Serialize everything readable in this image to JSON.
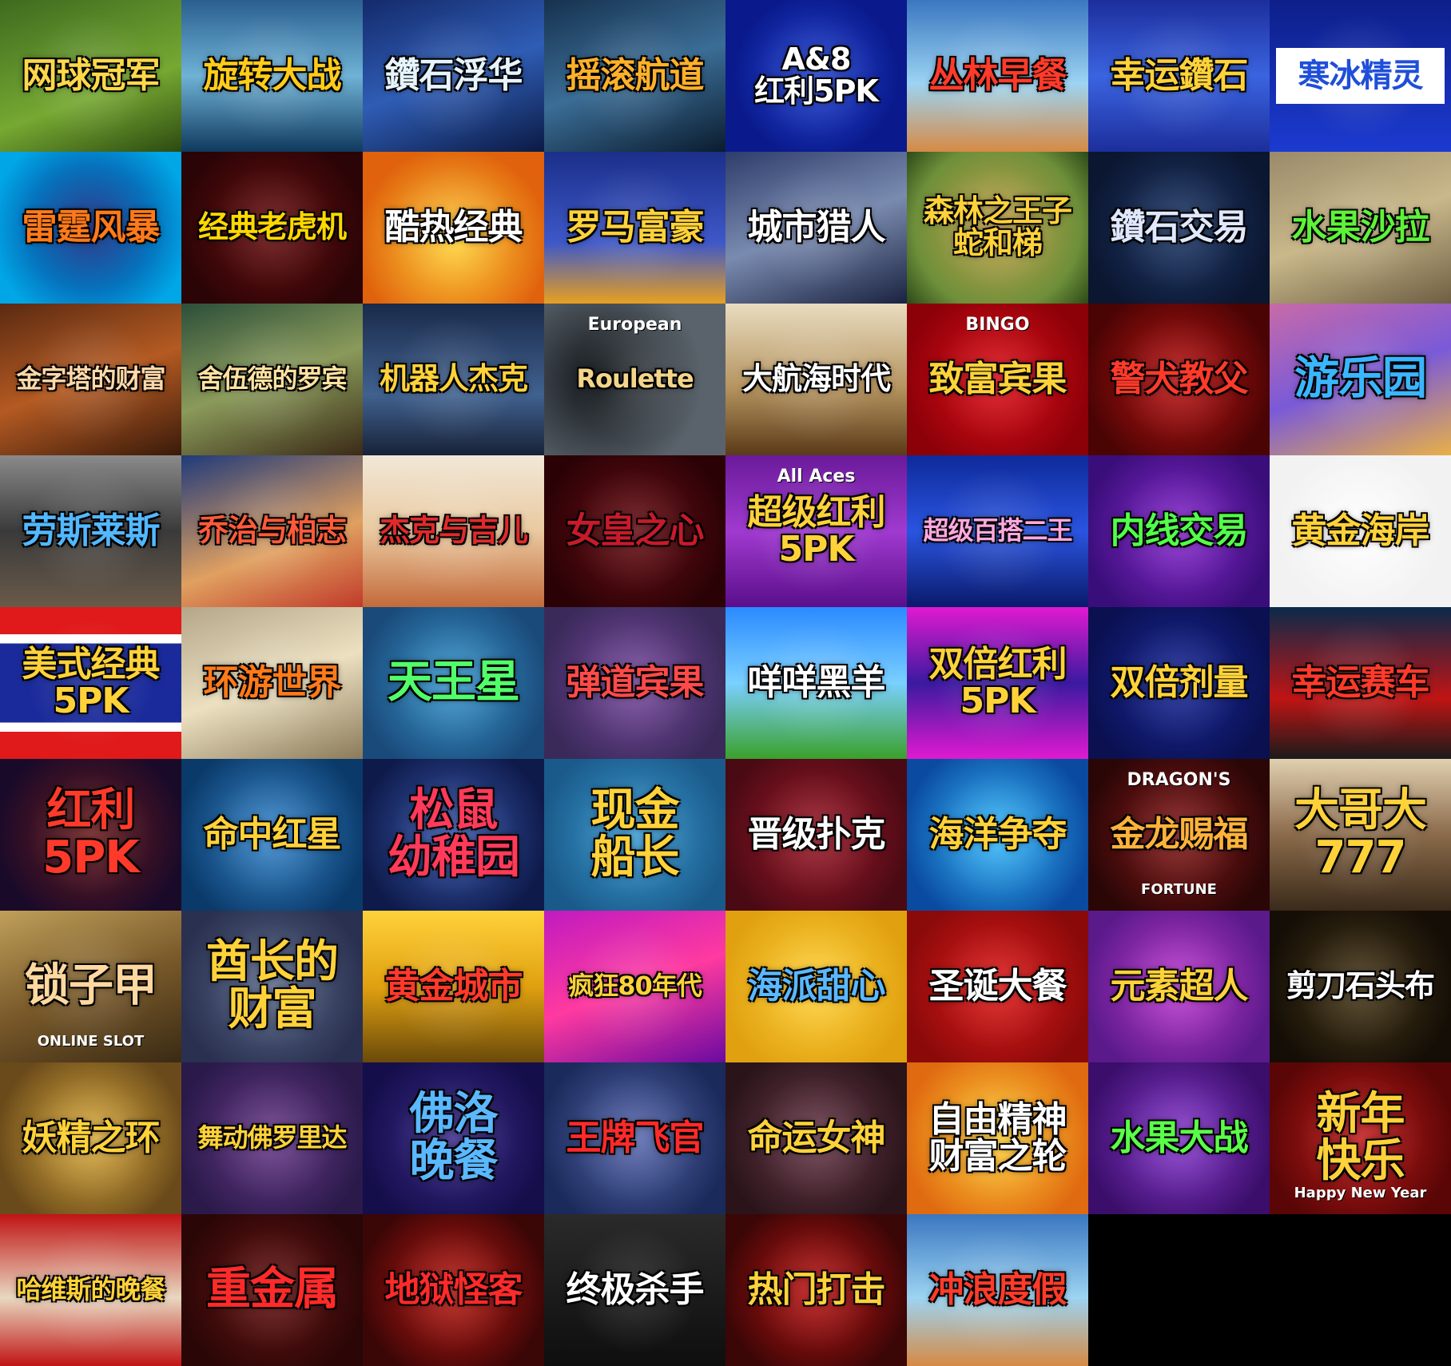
{
  "tiles": [
    {
      "label": "网球冠军",
      "bg": "linear-gradient(160deg,#3d6b1f,#76a832 60%,#2c4a10)",
      "color": "#ffd84a"
    },
    {
      "label": "旋转大战",
      "bg": "linear-gradient(180deg,#2a5f8f,#6fb2d6 50%,#0f3a5e)",
      "color": "#ffcc1a"
    },
    {
      "label": "鑽石浮华",
      "bg": "linear-gradient(160deg,#142a6b,#2f5db5 50%,#0b1a44)",
      "color": "#e6f4ff"
    },
    {
      "label": "摇滚航道",
      "bg": "linear-gradient(160deg,#16324f,#3b6d96 50%,#0a1c2e)",
      "color": "#ffb12a"
    },
    {
      "label": "A&8\n红利5PK",
      "bg": "radial-gradient(circle at 50% 50%,#2446d6,#0a1a8c 70%)",
      "color": "#ffffff"
    },
    {
      "label": "丛林早餐",
      "bg": "linear-gradient(180deg,#3a77c0,#9cd4f2 55%,#d68a44)",
      "color": "#ff3b2a"
    },
    {
      "label": "幸运鑽石",
      "bg": "linear-gradient(180deg,#1c2e9c,#3b64e0 50%,#1c2e9c)",
      "color": "#ffd23a"
    },
    {
      "label": "寒冰精灵",
      "bg": "linear-gradient(180deg,#0d1f8a,#1b3ad0)",
      "color": "#1f4fd8",
      "inner": "#ffffff"
    },
    {
      "label": "雷霆风暴",
      "bg": "radial-gradient(circle,#0e1f7a 0%,#00a6e6 85%)",
      "color": "#ff7a1a"
    },
    {
      "label": "经典老虎机",
      "bg": "radial-gradient(circle,#6b0f10,#2a0406 80%)",
      "color": "#ffd800"
    },
    {
      "label": "酷热经典",
      "bg": "radial-gradient(circle at 50% 60%,#ffd23a,#e0620c 75%)",
      "color": "#ffffff"
    },
    {
      "label": "罗马富豪",
      "bg": "linear-gradient(180deg,#1b2f8a,#3e58c8 60%,#e8a020)",
      "color": "#ffd23a"
    },
    {
      "label": "城市猎人",
      "bg": "linear-gradient(160deg,#2e3d6b,#7a8bb0 50%,#1a2240)",
      "color": "#ffffff"
    },
    {
      "label": "森林之王子\n蛇和梯",
      "bg": "radial-gradient(circle,#c7a24a,#6e8f3a 70%,#2b4a18)",
      "color": "#ffd23a"
    },
    {
      "label": "鑽石交易",
      "bg": "radial-gradient(circle,#1f3a6b,#0b1630 80%)",
      "color": "#dfe8ff"
    },
    {
      "label": "水果沙拉",
      "bg": "linear-gradient(160deg,#9a8a6a,#c9b88a 50%,#6e5f44)",
      "color": "#5ef23a"
    },
    {
      "label": "金字塔的财富",
      "bg": "linear-gradient(160deg,#5a2a12,#b45a22 50%,#3a1a0a)",
      "color": "#ffd8a8"
    },
    {
      "label": "舍伍德的罗宾",
      "bg": "linear-gradient(160deg,#2c4f3a,#8a9a5a 50%,#3a2a16)",
      "color": "#ffe2a0"
    },
    {
      "label": "机器人杰克",
      "bg": "linear-gradient(180deg,#1a2a4a,#40618f 60%,#182238)",
      "color": "#ffd23a"
    },
    {
      "label": "Roulette",
      "top": "European",
      "bg": "radial-gradient(circle at 30% 50%,#101418,#5a636b 70%)",
      "color": "#f3d58a"
    },
    {
      "label": "大航海时代",
      "bg": "linear-gradient(180deg,#e9dcc0,#b59460 55%,#5a3a18)",
      "color": "#ffffff"
    },
    {
      "label": "致富宾果",
      "top": "BINGO",
      "bg": "radial-gradient(circle,#e0101a,#8c0008 80%)",
      "color": "#ffd23a"
    },
    {
      "label": "警犬教父",
      "bg": "radial-gradient(circle,#c01414,#4a0404 80%)",
      "color": "#ff3a2a"
    },
    {
      "label": "游乐园",
      "bg": "linear-gradient(160deg,#c86aa8,#7a5ad8 50%,#e8b048)",
      "color": "#3ab6ff"
    },
    {
      "label": "劳斯莱斯",
      "bg": "linear-gradient(180deg,#8a8a8a,#3a3a3a 50%,#6a5a4a)",
      "color": "#52b8ff"
    },
    {
      "label": "乔治与柏志",
      "bg": "linear-gradient(160deg,#1f3a7a,#e0a060 60%,#c03a2a)",
      "color": "#ff5a3a"
    },
    {
      "label": "杰克与吉儿",
      "bg": "linear-gradient(180deg,#f2e8d8,#e9c9a0 50%,#c46a3a)",
      "color": "#e02a2a"
    },
    {
      "label": "女皇之心",
      "bg": "radial-gradient(circle,#6a0e14,#2a0206 80%)",
      "color": "#c81a2a"
    },
    {
      "label": "超级红利\n5PK",
      "top": "All Aces",
      "bg": "linear-gradient(180deg,#6a1a9a,#a03ad0 50%,#5a0e8a)",
      "color": "#ffd23a"
    },
    {
      "label": "超级百搭二王",
      "bg": "linear-gradient(180deg,#0e2a9a,#2a54e0 50%,#0a1a6a)",
      "color": "#ffa8e0"
    },
    {
      "label": "内线交易",
      "bg": "radial-gradient(circle,#8a2ad0,#3a0e7a 80%)",
      "color": "#52ff4a"
    },
    {
      "label": "黄金海岸",
      "bg": "radial-gradient(circle,#ffffff,#f2f2f2 70%)",
      "color": "#ffd23a"
    },
    {
      "label": "美式经典\n5PK",
      "bg": "linear-gradient(180deg,#e01a1a 0 18%,#ffffff 18% 24%,#1a2a9a 24% 76%,#ffffff 76% 82%,#e01a1a 82%)",
      "color": "#ffd23a"
    },
    {
      "label": "环游世界",
      "bg": "linear-gradient(160deg,#b5a68a,#ece0c0 50%,#8a7a5a)",
      "color": "#ff7a1a"
    },
    {
      "label": "天王星",
      "bg": "radial-gradient(circle,#3a9ad0,#1a4a7a 80%)",
      "color": "#52ff6a"
    },
    {
      "label": "弹道宾果",
      "bg": "radial-gradient(circle,#7a4aa0,#3a2a5a 80%)",
      "color": "#ff4a4a"
    },
    {
      "label": "咩咩黑羊",
      "bg": "linear-gradient(180deg,#2a8aff,#7ad0ff 50%,#3aa02a)",
      "color": "#ffffff"
    },
    {
      "label": "双倍红利\n5PK",
      "bg": "linear-gradient(180deg,#e01ad0,#3a1aa0 50%,#e01ad0)",
      "color": "#ffd23a"
    },
    {
      "label": "双倍剂量",
      "bg": "radial-gradient(circle,#1a2a9a,#0a1050 80%)",
      "color": "#ffd23a"
    },
    {
      "label": "幸运赛车",
      "bg": "linear-gradient(180deg,#0a2a4a,#c01414 60%,#1a1a1a)",
      "color": "#ff3a2a"
    },
    {
      "label": "红利\n5PK",
      "bg": "radial-gradient(circle,#6a1a1a,#1a0a2a 80%)",
      "color": "#ff3a2a"
    },
    {
      "label": "命中红星",
      "bg": "radial-gradient(circle,#3a8ad0,#0a3a6a 80%)",
      "color": "#ffd23a"
    },
    {
      "label": "松鼠\n幼稚园",
      "bg": "radial-gradient(circle,#3a5ab0,#0e1a4a 80%)",
      "color": "#ff3a5a"
    },
    {
      "label": "现金\n船长",
      "bg": "radial-gradient(circle,#3a9ad0,#1a5a8a 80%)",
      "color": "#ffd23a"
    },
    {
      "label": "晋级扑克",
      "bg": "radial-gradient(circle,#a01a2a,#4a0a14 80%)",
      "color": "#ffffff"
    },
    {
      "label": "海洋争夺",
      "bg": "radial-gradient(circle,#3ac0ff,#0a4aa0 80%)",
      "color": "#ffd23a"
    },
    {
      "label": "金龙赐福",
      "top": "DRAGON'S",
      "sub": "FORTUNE",
      "bg": "radial-gradient(circle,#8a1a1a,#2a0606 80%)",
      "color": "#ffb23a"
    },
    {
      "label": "大哥大\n777",
      "bg": "linear-gradient(180deg,#e0d0b0,#8a6a4a 50%,#3a2a1a)",
      "color": "#ffd23a"
    },
    {
      "label": "锁子甲",
      "sub": "ONLINE SLOT",
      "bg": "linear-gradient(160deg,#c0a05a,#7a5a2a 50%,#3a2a14)",
      "color": "#ffd8a0"
    },
    {
      "label": "酋长的\n财富",
      "bg": "radial-gradient(circle,#5a6a8a,#2a3050 80%)",
      "color": "#ffd23a"
    },
    {
      "label": "黄金城市",
      "bg": "linear-gradient(180deg,#ffd23a,#e0a010 50%,#6a4a0a)",
      "color": "#ff3a2a"
    },
    {
      "label": "疯狂80年代",
      "bg": "linear-gradient(160deg,#c01ac0,#ff3aa0 50%,#6a0aa0)",
      "color": "#ffd23a"
    },
    {
      "label": "海派甜心",
      "bg": "radial-gradient(circle,#ffd23a,#e0a010 80%)",
      "color": "#5ab8ff"
    },
    {
      "label": "圣诞大餐",
      "bg": "radial-gradient(circle,#e01a1a,#8a0a0a 80%)",
      "color": "#ffffff"
    },
    {
      "label": "元素超人",
      "bg": "radial-gradient(circle,#c03ad0,#5a1a8a 80%)",
      "color": "#ffd23a"
    },
    {
      "label": "剪刀石头布",
      "bg": "radial-gradient(circle,#4a3a1a,#140e06 80%)",
      "color": "#ffffff"
    },
    {
      "label": "妖精之环",
      "bg": "radial-gradient(circle,#e0b040,#6a4a1a 80%)",
      "color": "#ffd23a"
    },
    {
      "label": "舞动佛罗里达",
      "bg": "radial-gradient(circle,#6a3a8a,#2a1a4a 80%)",
      "color": "#ffd23a"
    },
    {
      "label": "佛洛\n晚餐",
      "bg": "radial-gradient(circle,#3a2a8a,#140e4a 80%)",
      "color": "#5ab8ff"
    },
    {
      "label": "王牌飞官",
      "bg": "radial-gradient(circle,#5a6ab0,#1a2a5a 80%)",
      "color": "#ff2a2a"
    },
    {
      "label": "命运女神",
      "bg": "radial-gradient(circle,#6a3a4a,#2a141a 80%)",
      "color": "#ffd23a"
    },
    {
      "label": "自由精神\n财富之轮",
      "bg": "radial-gradient(circle,#ffd23a,#e06a10 80%)",
      "color": "#ffffff"
    },
    {
      "label": "水果大战",
      "bg": "radial-gradient(circle,#8a3ad0,#3a0e6a 80%)",
      "color": "#5aff4a"
    },
    {
      "label": "新年\n快乐",
      "sub": "Happy New Year",
      "bg": "radial-gradient(circle,#c01a1a,#5a0606 80%)",
      "color": "#ffd23a"
    },
    {
      "label": "哈维斯的晚餐",
      "bg": "linear-gradient(180deg,#c01414,#e8d8c0 55%,#c01414)",
      "color": "#ffd23a"
    },
    {
      "label": "重金属",
      "bg": "radial-gradient(circle,#6a1414,#2a0606 80%)",
      "color": "#ff2a2a"
    },
    {
      "label": "地狱怪客",
      "bg": "radial-gradient(circle,#c01a14,#3a0606 80%)",
      "color": "#ff2a2a"
    },
    {
      "label": "终极杀手",
      "bg": "linear-gradient(180deg,#2a2a2a,#0e0e0e)",
      "color": "#ffffff"
    },
    {
      "label": "热门打击",
      "bg": "radial-gradient(circle,#c01414,#3a0606 80%)",
      "color": "#ffd23a"
    },
    {
      "label": "冲浪度假",
      "bg": "linear-gradient(180deg,#3a77c0,#9cd4f2 55%,#d68a44)",
      "color": "#ff3b2a"
    },
    {
      "label": "",
      "bg": "#000000",
      "empty": true
    },
    {
      "label": "",
      "bg": "#000000",
      "empty": true
    }
  ]
}
